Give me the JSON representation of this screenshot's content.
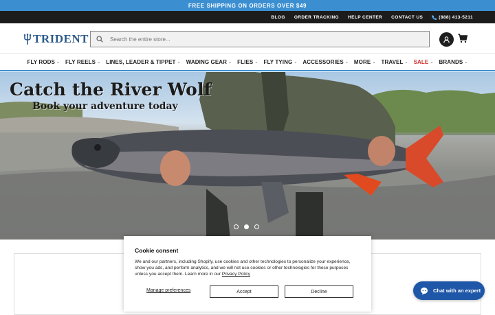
{
  "promo_bar": {
    "text": "FREE SHIPPING ON ORDERS OVER $49"
  },
  "utility_nav": {
    "links": [
      "BLOG",
      "ORDER TRACKING",
      "HELP CENTER",
      "CONTACT US"
    ],
    "phone": "(888) 413-5211"
  },
  "header": {
    "logo_text": "TRIDENT",
    "search_placeholder": "Search the entire store..."
  },
  "main_nav": {
    "items": [
      {
        "label": "FLY RODS"
      },
      {
        "label": "FLY REELS"
      },
      {
        "label": "LINES, LEADER & TIPPET"
      },
      {
        "label": "WADING GEAR"
      },
      {
        "label": "FLIES"
      },
      {
        "label": "FLY TYING"
      },
      {
        "label": "ACCESSORIES"
      },
      {
        "label": "MORE"
      },
      {
        "label": "TRAVEL"
      },
      {
        "label": "SALE"
      },
      {
        "label": "BRANDS"
      }
    ],
    "sale_color": "#d0312d"
  },
  "hero": {
    "title": "Catch the River Wolf",
    "subtitle": "Book your adventure today",
    "slide_count": 3,
    "active_slide": 1
  },
  "cookie_banner": {
    "title": "Cookie consent",
    "body": "We and our partners, including Shopify, use cookies and other technologies to personalize your experience, show you ads, and perform analytics, and we will not use cookies or other technologies for these purposes unless you accept them. Learn more in our",
    "privacy_link": "Privacy Policy",
    "manage_label": "Manage preferences",
    "accept_label": "Accept",
    "decline_label": "Decline"
  },
  "chat_widget": {
    "label": "Chat with an expert"
  },
  "colors": {
    "accent": "#3b8fd1",
    "brand_navy": "#2d5a8a",
    "chat_button": "#1f57a8",
    "utility_bar": "#1c1c1c"
  },
  "icons": [
    "phone-icon",
    "trident-logo-icon",
    "search-icon",
    "account-icon",
    "cart-icon",
    "chevron-down-icon",
    "chat-bubble-icon"
  ]
}
